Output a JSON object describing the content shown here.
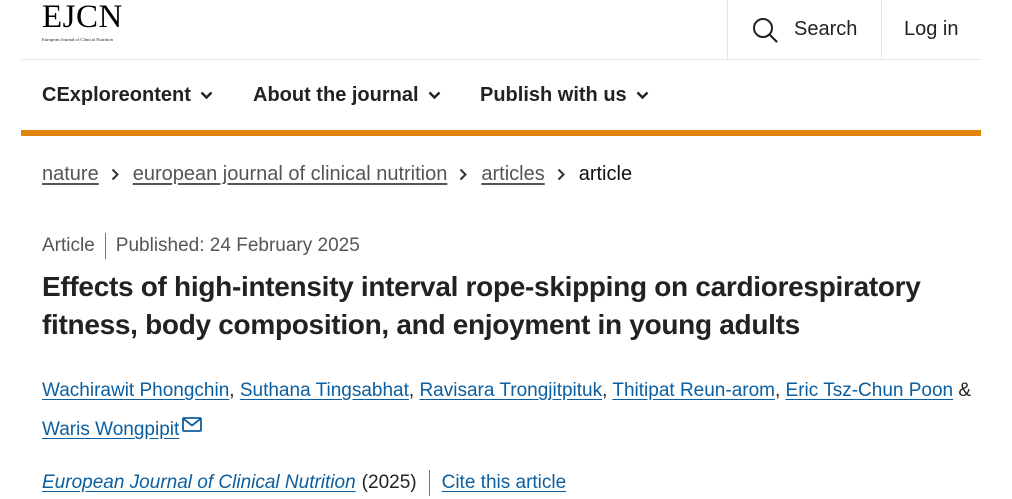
{
  "header": {
    "logo_text": "EJCN",
    "logo_subtext": "European Journal of Clinical Nutrition",
    "search_label": "Search",
    "login_label": "Log in"
  },
  "nav": {
    "items": [
      {
        "label": "CExploreontent"
      },
      {
        "label": "About the journal"
      },
      {
        "label": "Publish with us"
      }
    ],
    "accent_color": "#e0860d"
  },
  "breadcrumb": {
    "items": [
      {
        "label": "nature"
      },
      {
        "label": "european journal of clinical nutrition"
      },
      {
        "label": "articles"
      }
    ],
    "current": "article"
  },
  "article": {
    "type": "Article",
    "published": "Published: 24 February 2025",
    "title": "Effects of high-intensity interval rope-skipping on cardiorespiratory fitness, body composition, and enjoyment in young adults",
    "authors": [
      "Wachirawit Phongchin",
      "Suthana Tingsabhat",
      "Ravisara Trongjitpituk",
      "Thitipat Reun-arom",
      "Eric Tsz-Chun Poon",
      "Waris Wongpipit"
    ],
    "author_sep": ", ",
    "author_last_sep": " & ",
    "journal": "European Journal of Clinical Nutrition",
    "year": "(2025)",
    "cite_label": "Cite this article",
    "link_color": "#0b5fa0"
  }
}
